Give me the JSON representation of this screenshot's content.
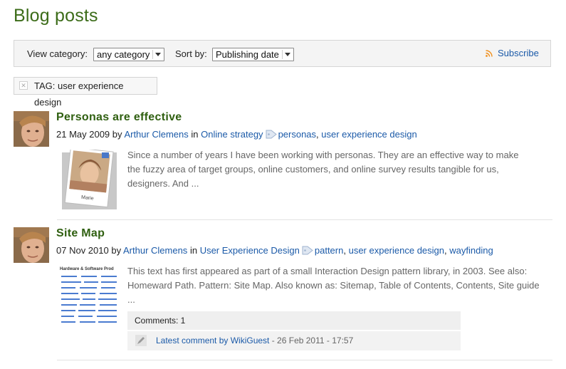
{
  "page": {
    "title": "Blog posts"
  },
  "toolbar": {
    "view_category_label": "View category:",
    "category_value": "any category",
    "sort_by_label": "Sort by:",
    "sort_value": "Publishing date",
    "subscribe_label": "Subscribe"
  },
  "tag_filter": {
    "prefix": "TAG:",
    "value": "user experience design"
  },
  "posts": [
    {
      "title": "Personas are effective",
      "date": "21 May 2009",
      "by": "by",
      "author": "Arthur Clemens",
      "in": "in",
      "category": "Online strategy",
      "tags": [
        "personas",
        "user experience design"
      ],
      "excerpt": "Since a number of years I have been working with personas. They are an effective way to make the fuzzy area of target groups, online customers, and online survey results tangible for us, designers. And ...",
      "thumb_caption": "Marie"
    },
    {
      "title": "Site Map",
      "date": "07 Nov 2010",
      "by": "by",
      "author": "Arthur Clemens",
      "in": "in",
      "category": "User Experience Design",
      "tags": [
        "pattern",
        "user experience design",
        "wayfinding"
      ],
      "excerpt": "This text has first appeared as part of a small Interaction Design pattern library, in 2003. See also: Homeward Path. Pattern: Site Map. Also known as: Sitemap, Table of Contents, Contents, Site guide ...",
      "thumb_heading": "Hardware & Software Prod",
      "comments_label": "Comments: 1",
      "latest_comment_link": "Latest comment by WikiGuest",
      "latest_comment_date": " - 26 Feb 2011 - 17:57"
    }
  ],
  "colors": {
    "title": "#3c6c19",
    "link": "#1b5aa8",
    "post_title": "#2f5f10"
  }
}
